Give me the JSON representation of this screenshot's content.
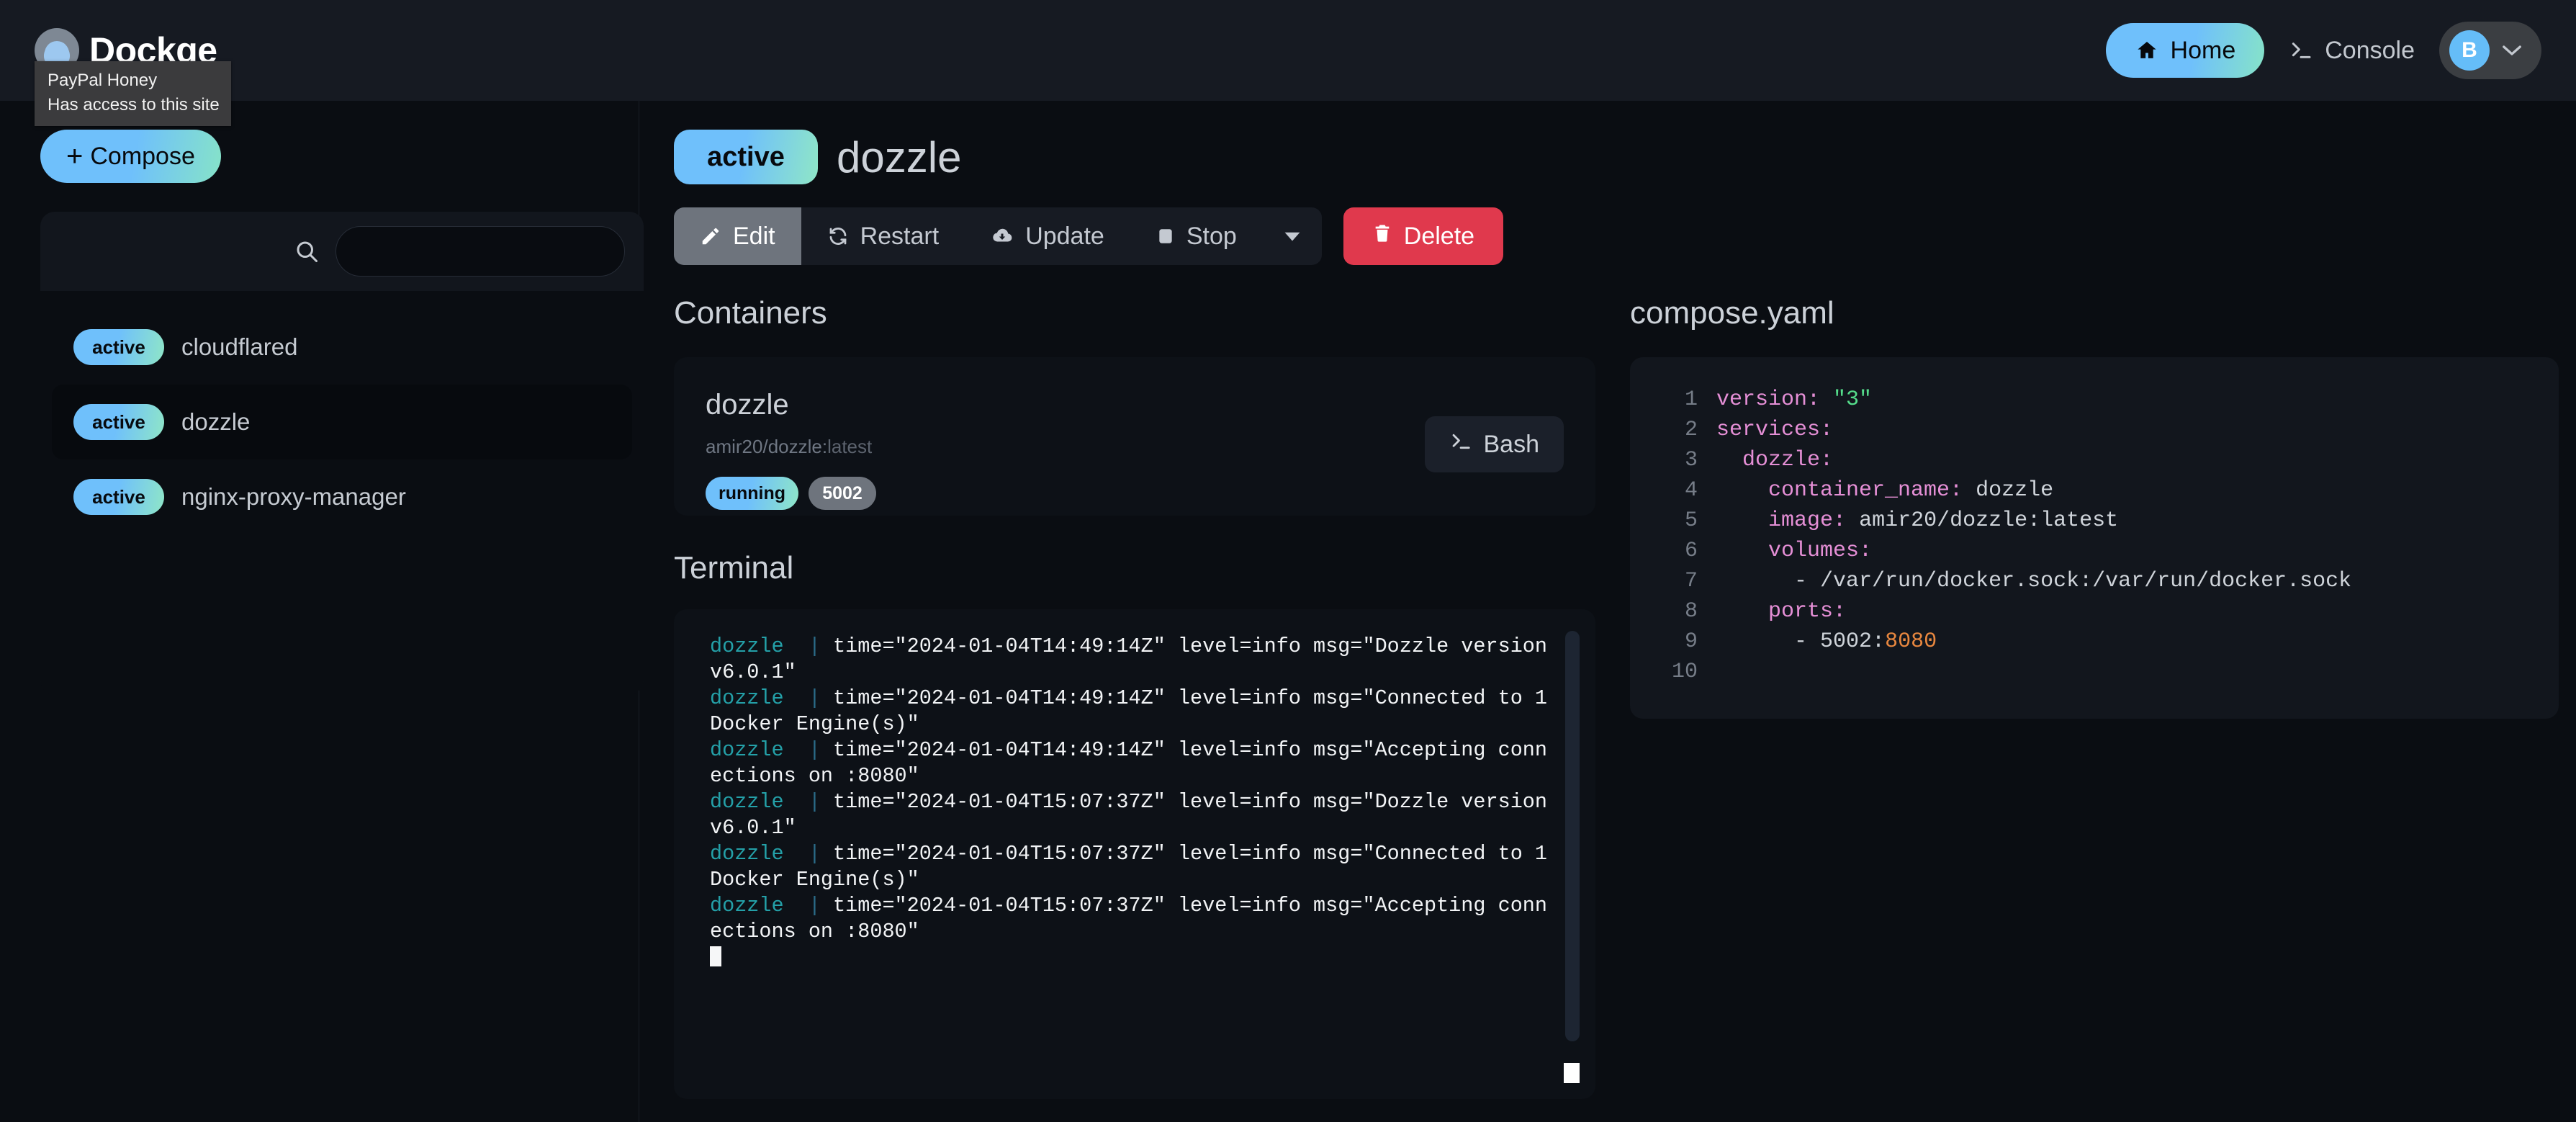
{
  "header": {
    "brand": "Dockge",
    "logo_icon": "dockge-logo-icon",
    "tooltip": {
      "title": "PayPal Honey",
      "subtitle": "Has access to this site"
    },
    "home_label": "Home",
    "home_icon": "home-icon",
    "console_label": "Console",
    "console_icon": "terminal-prompt-icon",
    "avatar_initial": "B",
    "chevron_icon": "chevron-down-icon"
  },
  "sidebar": {
    "compose_label": "Compose",
    "compose_plus": "+",
    "search_icon": "search-icon",
    "search_value": "",
    "search_placeholder": "",
    "stacks": [
      {
        "status": "active",
        "name": "cloudflared",
        "selected": false
      },
      {
        "status": "active",
        "name": "dozzle",
        "selected": true
      },
      {
        "status": "active",
        "name": "nginx-proxy-manager",
        "selected": false
      }
    ]
  },
  "main": {
    "status_badge": "active",
    "title": "dozzle",
    "actions": [
      {
        "label": "Edit",
        "icon": "pencil-icon",
        "active": true
      },
      {
        "label": "Restart",
        "icon": "refresh-icon",
        "active": false
      },
      {
        "label": "Update",
        "icon": "cloud-download-icon",
        "active": false
      },
      {
        "label": "Stop",
        "icon": "stop-square-icon",
        "active": false
      }
    ],
    "action_caret_icon": "caret-down-icon",
    "delete_label": "Delete",
    "delete_icon": "trash-icon",
    "delete_color": "#e0394d",
    "accent_color": "#6fc0fb",
    "accent_color_2": "#86e3c8",
    "containers_heading": "Containers",
    "container": {
      "name": "dozzle",
      "image_repo": "amir20/dozzle:",
      "image_tag": "latest",
      "state": "running",
      "port": "5002",
      "bash_label": "Bash",
      "bash_icon": "terminal-prompt-icon"
    },
    "terminal_heading": "Terminal",
    "terminal_lines": [
      {
        "service": "dozzle",
        "text": "time=\"2024-01-04T14:49:14Z\" level=info msg=\"Dozzle version v6.0.1\""
      },
      {
        "service": "dozzle",
        "text": "time=\"2024-01-04T14:49:14Z\" level=info msg=\"Connected to 1 Docker Engine(s)\""
      },
      {
        "service": "dozzle",
        "text": "time=\"2024-01-04T14:49:14Z\" level=info msg=\"Accepting connections on :8080\""
      },
      {
        "service": "dozzle",
        "text": "time=\"2024-01-04T15:07:37Z\" level=info msg=\"Dozzle version v6.0.1\""
      },
      {
        "service": "dozzle",
        "text": "time=\"2024-01-04T15:07:37Z\" level=info msg=\"Connected to 1 Docker Engine(s)\""
      },
      {
        "service": "dozzle",
        "text": "time=\"2024-01-04T15:07:37Z\" level=info msg=\"Accepting connections on :8080\""
      }
    ],
    "compose_heading": "compose.yaml",
    "compose_lines": [
      {
        "n": "1",
        "indent": 0,
        "key": "version:",
        "value": "",
        "string": "\"3\"",
        "port": ""
      },
      {
        "n": "2",
        "indent": 0,
        "key": "services:",
        "value": "",
        "string": "",
        "port": ""
      },
      {
        "n": "3",
        "indent": 1,
        "key": "dozzle:",
        "value": "",
        "string": "",
        "port": ""
      },
      {
        "n": "4",
        "indent": 2,
        "key": "container_name:",
        "value": "dozzle",
        "string": "",
        "port": ""
      },
      {
        "n": "5",
        "indent": 2,
        "key": "image:",
        "value": "amir20/dozzle:latest",
        "string": "",
        "port": ""
      },
      {
        "n": "6",
        "indent": 2,
        "key": "volumes:",
        "value": "",
        "string": "",
        "port": ""
      },
      {
        "n": "7",
        "indent": 3,
        "key": "",
        "value": "- /var/run/docker.sock:/var/run/docker.sock",
        "string": "",
        "port": ""
      },
      {
        "n": "8",
        "indent": 2,
        "key": "ports:",
        "value": "",
        "string": "",
        "port": ""
      },
      {
        "n": "9",
        "indent": 3,
        "key": "",
        "value": "- 5002:",
        "string": "",
        "port": "8080"
      },
      {
        "n": "10",
        "indent": 0,
        "key": "",
        "value": "",
        "string": "",
        "port": ""
      }
    ]
  }
}
